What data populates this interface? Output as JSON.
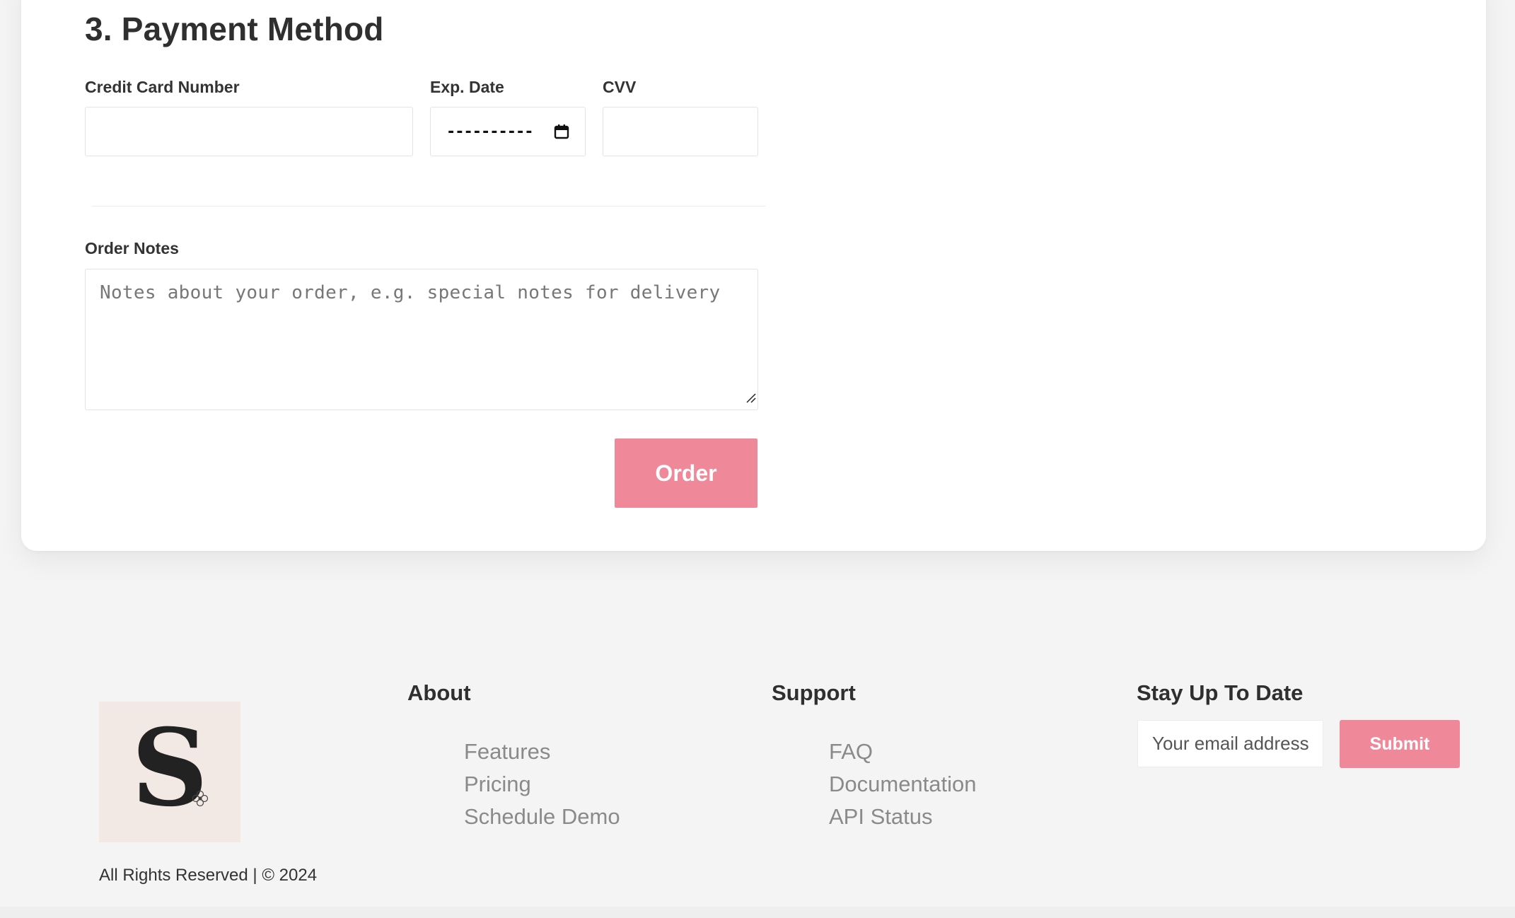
{
  "payment": {
    "title": "3. Payment Method",
    "card_number_label": "Credit Card Number",
    "card_number_value": "",
    "exp_date_label": "Exp. Date",
    "exp_date_placeholder": "----------",
    "cvv_label": "CVV",
    "cvv_value": ""
  },
  "notes": {
    "label": "Order Notes",
    "placeholder": "Notes about your order, e.g. special notes for delivery"
  },
  "order_button": "Order",
  "footer": {
    "copyright": "All Rights Reserved | © 2024",
    "about": {
      "heading": "About",
      "links": [
        "Features",
        "Pricing",
        "Schedule Demo"
      ]
    },
    "support": {
      "heading": "Support",
      "links": [
        "FAQ",
        "Documentation",
        "API Status"
      ]
    },
    "newsletter": {
      "heading": "Stay Up To Date",
      "email_placeholder": "Your email address",
      "submit_label": "Submit"
    }
  },
  "colors": {
    "accent": "#ef899a",
    "page_bg": "#f4f4f4",
    "logo_bg": "#f3e9e4"
  },
  "icons": {
    "calendar": "calendar-icon",
    "logo": "brand-s-logo"
  }
}
